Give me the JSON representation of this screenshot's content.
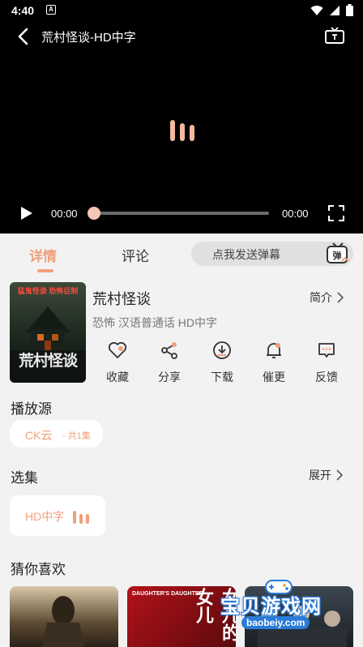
{
  "status_bar": {
    "time": "4:40",
    "notification_letter": "A"
  },
  "player": {
    "title": "荒村怪谈-HD中字",
    "current_time": "00:00",
    "total_time": "00:00",
    "progress": 0
  },
  "tabs": {
    "detail": "详情",
    "comment": "评论",
    "danmu_placeholder": "点我发送弹幕",
    "danmu_icon_text": "弹"
  },
  "movie": {
    "title": "荒村怪谈",
    "intro_label": "简介",
    "meta": "恐怖 汉语普通话 HD中字",
    "poster_top_text": "猛鬼怪谈 恐怖巨制",
    "poster_title": "荒村怪谈"
  },
  "actions": [
    {
      "label": "收藏",
      "icon": "heart-icon"
    },
    {
      "label": "分享",
      "icon": "share-icon"
    },
    {
      "label": "下载",
      "icon": "download-icon"
    },
    {
      "label": "催更",
      "icon": "bell-icon"
    },
    {
      "label": "反馈",
      "icon": "feedback-icon"
    }
  ],
  "source": {
    "title": "播放源",
    "name": "CK云",
    "count": "· 共1集"
  },
  "episodes": {
    "title": "选集",
    "expand_label": "展开",
    "items": [
      {
        "label": "HD中字"
      }
    ]
  },
  "recommend": {
    "title": "猜你喜欢",
    "card2_text": "DAUGHTER'S DAUGHTER",
    "card2_big": "女儿的女儿"
  },
  "watermark": {
    "title": "宝贝游戏网",
    "url": "baobeiy.com"
  },
  "colors": {
    "accent": "#f0a07c",
    "background": "#f2f2f2",
    "player": "#000000"
  }
}
